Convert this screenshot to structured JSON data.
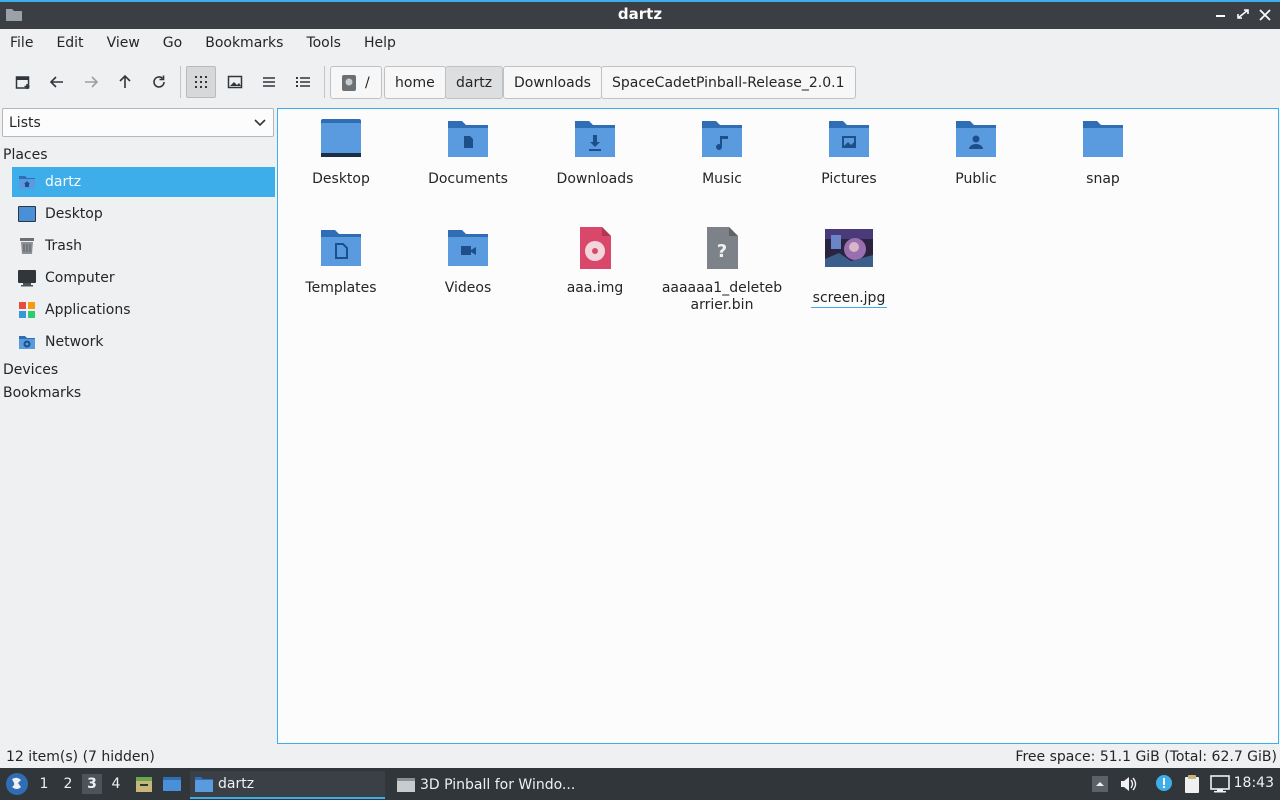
{
  "window": {
    "title": "dartz"
  },
  "menubar": [
    "File",
    "Edit",
    "View",
    "Go",
    "Bookmarks",
    "Tools",
    "Help"
  ],
  "breadcrumbs": [
    "/",
    "home",
    "dartz",
    "Downloads",
    "SpaceCadetPinball-Release_2.0.1"
  ],
  "sidebar": {
    "selector": "Lists",
    "places_header": "Places",
    "places": [
      "dartz",
      "Desktop",
      "Trash",
      "Computer",
      "Applications",
      "Network"
    ],
    "devices_header": "Devices",
    "bookmarks_header": "Bookmarks"
  },
  "files": [
    {
      "name": "Desktop",
      "icon": "desktop-folder-icon"
    },
    {
      "name": "Documents",
      "icon": "documents-folder-icon"
    },
    {
      "name": "Downloads",
      "icon": "downloads-folder-icon"
    },
    {
      "name": "Music",
      "icon": "music-folder-icon"
    },
    {
      "name": "Pictures",
      "icon": "pictures-folder-icon"
    },
    {
      "name": "Public",
      "icon": "public-folder-icon"
    },
    {
      "name": "snap",
      "icon": "folder-icon"
    },
    {
      "name": "Templates",
      "icon": "templates-folder-icon"
    },
    {
      "name": "Videos",
      "icon": "videos-folder-icon"
    },
    {
      "name": "aaa.img",
      "icon": "disk-image-icon"
    },
    {
      "name": "aaaaaa1_deletebarrier.bin",
      "icon": "unknown-file-icon"
    },
    {
      "name": "screen.jpg",
      "icon": "image-thumbnail-icon"
    }
  ],
  "status": {
    "left": "12 item(s) (7 hidden)",
    "right": "Free space: 51.1 GiB (Total: 62.7 GiB)"
  },
  "taskbar": {
    "workspaces": [
      "1",
      "2",
      "3",
      "4"
    ],
    "active_workspace": "3",
    "tasks": [
      "dartz",
      "3D Pinball for Windo..."
    ],
    "clock": "18:43"
  },
  "colors": {
    "accent": "#3daee9",
    "folder": "#4a90d9",
    "folder_tab": "#2f6db5"
  }
}
